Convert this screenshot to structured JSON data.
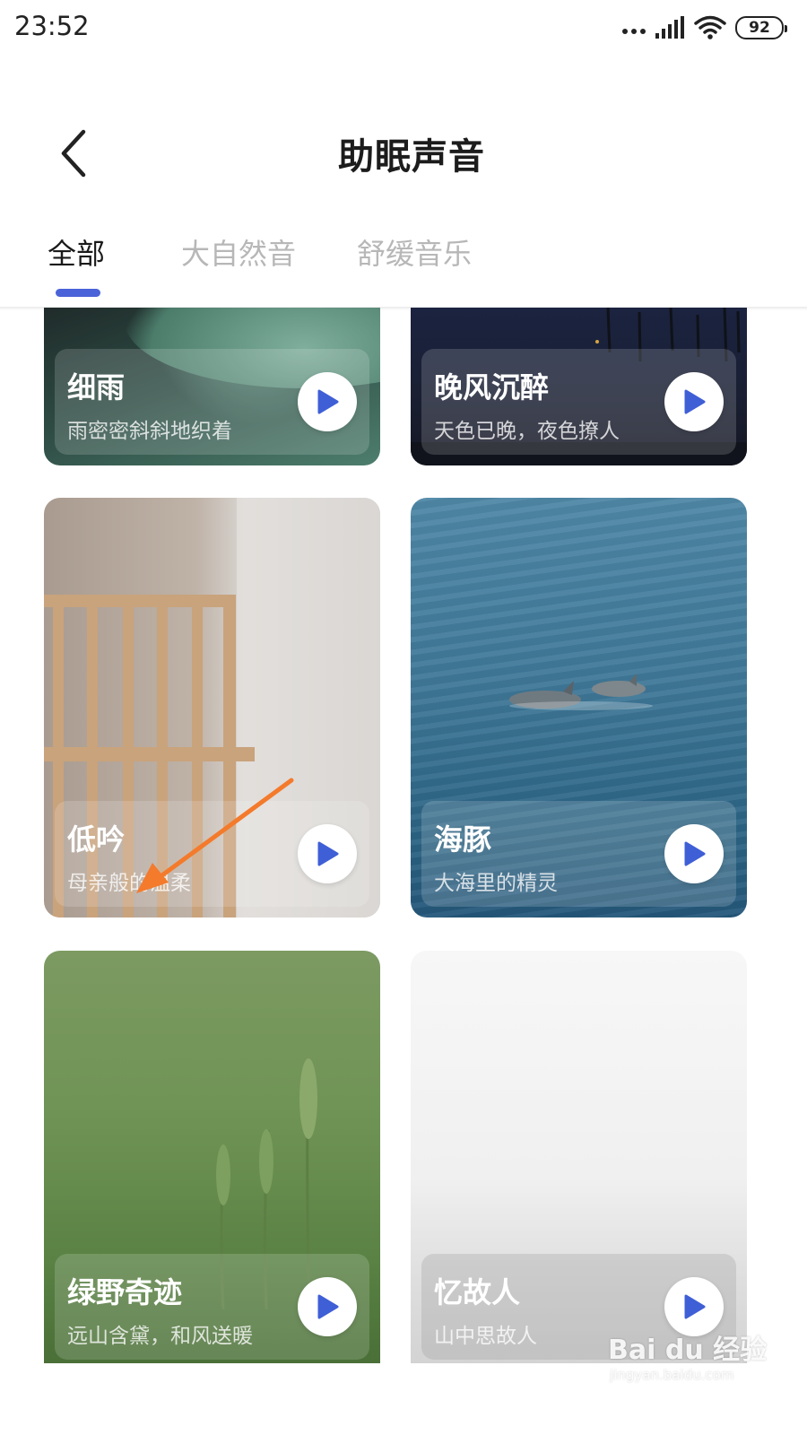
{
  "status_bar": {
    "time": "23:52",
    "battery": "92",
    "icons": [
      "more-dots-icon",
      "signal-icon",
      "wifi-icon",
      "battery-icon"
    ]
  },
  "header": {
    "title": "助眠声音",
    "back_icon": "chevron-left-icon"
  },
  "tabs": [
    {
      "label": "全部",
      "active": true
    },
    {
      "label": "大自然音",
      "active": false
    },
    {
      "label": "舒缓音乐",
      "active": false
    }
  ],
  "accent_color": "#4a63d8",
  "cards": [
    {
      "title": "细雨",
      "subtitle": "雨密密斜斜地织着",
      "icon": "play-icon"
    },
    {
      "title": "晚风沉醉",
      "subtitle": "天色已晚，夜色撩人",
      "icon": "play-icon"
    },
    {
      "title": "低吟",
      "subtitle": "母亲般的温柔",
      "icon": "play-icon"
    },
    {
      "title": "海豚",
      "subtitle": "大海里的精灵",
      "icon": "play-icon"
    },
    {
      "title": "绿野奇迹",
      "subtitle": "远山含黛，和风送暖",
      "icon": "play-icon"
    },
    {
      "title": "忆故人",
      "subtitle": "山中思故人",
      "icon": "play-icon"
    }
  ],
  "watermark": {
    "brand": "Bai du 经验",
    "url": "jingyan.baidu.com"
  }
}
